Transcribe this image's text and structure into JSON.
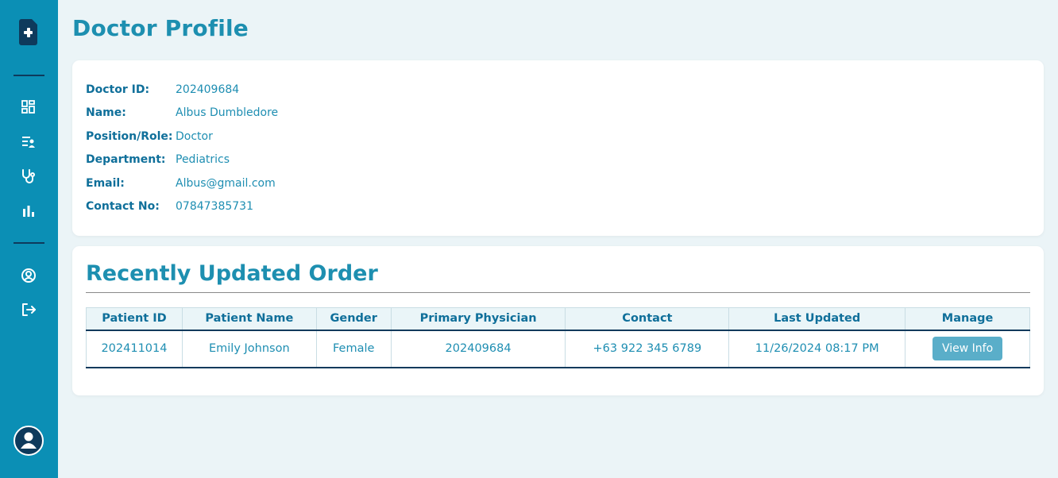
{
  "page": {
    "title": "Doctor Profile"
  },
  "profile": {
    "fields": [
      {
        "label": "Doctor ID:",
        "value": "202409684"
      },
      {
        "label": "Name:",
        "value": "Albus Dumbledore"
      },
      {
        "label": "Position/Role:",
        "value": "Doctor"
      },
      {
        "label": "Department:",
        "value": "Pediatrics"
      },
      {
        "label": "Email:",
        "value": "Albus@gmail.com"
      },
      {
        "label": "Contact No:",
        "value": "07847385731"
      }
    ]
  },
  "orders": {
    "title": "Recently Updated Order",
    "columns": [
      "Patient ID",
      "Patient Name",
      "Gender",
      "Primary Physician",
      "Contact",
      "Last Updated",
      "Manage"
    ],
    "rows": [
      {
        "patient_id": "202411014",
        "patient_name": "Emily Johnson",
        "gender": "Female",
        "primary_physician": "202409684",
        "contact": "+63 922 345 6789",
        "last_updated": "11/26/2024 08:17 PM",
        "manage_label": "View Info"
      }
    ]
  },
  "sidebar": {
    "icons": [
      "medical-file-icon",
      "dashboard-icon",
      "patient-list-icon",
      "stethoscope-icon",
      "bar-chart-icon",
      "user-circle-icon",
      "logout-icon",
      "avatar-icon"
    ]
  },
  "colors": {
    "sidebar": "#0b8fb5",
    "accent": "#1d8fb0",
    "label": "#0f6f9a",
    "button": "#5aaec9",
    "background": "#ebf4f7"
  }
}
